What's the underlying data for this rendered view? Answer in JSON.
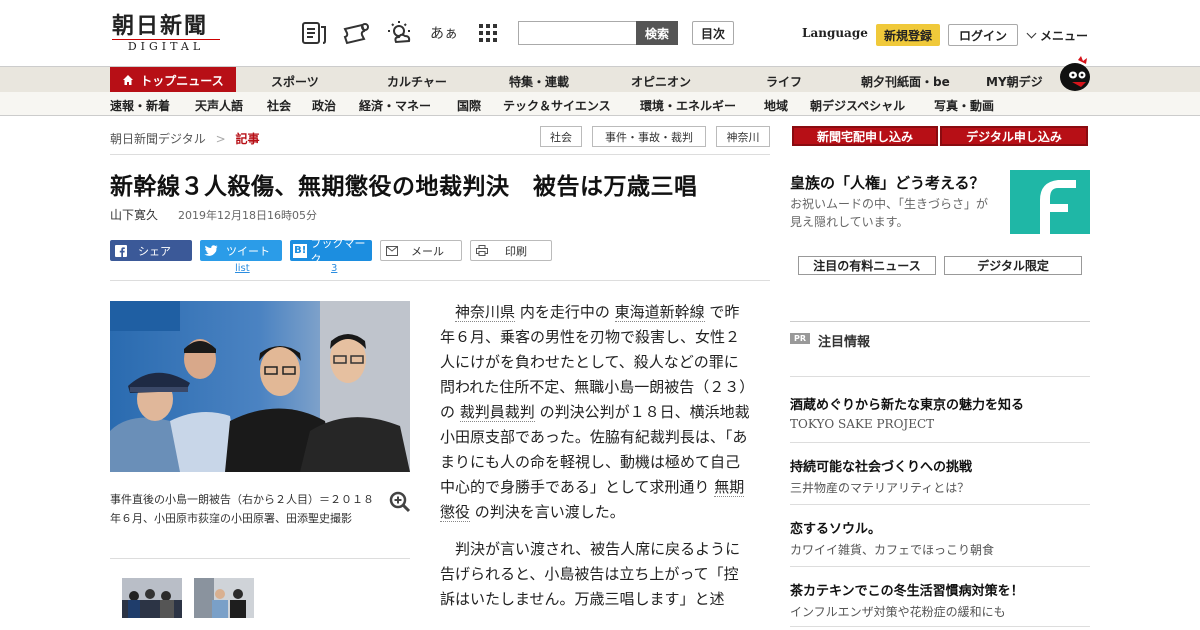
{
  "header": {
    "logo_main": "朝日新聞",
    "logo_sub": "DIGITAL",
    "icon_font_size": "あぁ",
    "search_placeholder": "",
    "search_button": "検索",
    "toc_button": "目次",
    "language": "Language",
    "signup": "新規登録",
    "login": "ログイン",
    "menu": "メニュー"
  },
  "nav_primary": [
    "トップニュース",
    "スポーツ",
    "カルチャー",
    "特集・連載",
    "オピニオン",
    "ライフ",
    "朝夕刊紙面・be",
    "MY朝デジ"
  ],
  "nav_secondary": [
    "速報・新着",
    "天声人語",
    "社会",
    "政治",
    "経済・マネー",
    "国際",
    "テック＆サイエンス",
    "環境・エネルギー",
    "地域",
    "朝デジスペシャル",
    "写真・動画"
  ],
  "breadcrumb": {
    "home": "朝日新聞デジタル",
    "sep": ">",
    "current": "記事"
  },
  "tags": [
    "社会",
    "事件・事故・裁判",
    "神奈川"
  ],
  "article": {
    "headline": "新幹線３人殺傷、無期懲役の地裁判決　被告は万歳三唱",
    "author": "山下寛久",
    "date": "2019年12月18日16時05分",
    "share": {
      "facebook": "シェア",
      "twitter": "ツイート",
      "hatena": "ブックマーク",
      "mail": "メール",
      "print": "印刷"
    },
    "share_counts": {
      "twitter": "list",
      "hatena": "3"
    },
    "caption": "事件直後の小島一朗被告（右から２人目）＝２０１８年６月、小田原市荻窪の小田原署、田添聖史撮影",
    "p1_a": "神奈川県",
    "p1_b": "内を走行中の",
    "p1_c": "東海道新幹線",
    "p1_d": "で昨年６月、乗客の男性を刃物で殺害し、女性２人にけがを負わせたとして、殺人などの罪に問われた住所不定、無職小島一朗被告（２３）の",
    "p1_e": "裁判員裁判",
    "p1_f": "の判決公判が１８日、横浜地裁小田原支部であった。佐脇有紀裁判長は、「あまりにも人の命を軽視し、動機は極めて自己中心的で身勝手である」として求刑通り",
    "p1_g": "無期懲役",
    "p1_h": "の判決を言い渡した。",
    "p2": "判決が言い渡され、被告人席に戻るように告げられると、小島被告は立ち上がって「控訴はいたしません。万歳三唱します」と述"
  },
  "sidebar": {
    "btn_newspaper": "新聞宅配申し込み",
    "btn_digital": "デジタル申し込み",
    "feature_title": "皇族の「人権」どう考える？",
    "feature_desc": "お祝いムードの中、「生きづらさ」が見え隠れしています。",
    "tab_paid": "注目の有料ニュース",
    "tab_digital": "デジタル限定",
    "pr_badge": "PR",
    "pr_label": "注目情報",
    "pr_items": [
      {
        "title": "酒蔵めぐりから新たな東京の魅力を知る",
        "sub": "TOKYO SAKE PROJECT"
      },
      {
        "title": "持続可能な社会づくりへの挑戦",
        "sub": "三井物産のマテリアリティとは？"
      },
      {
        "title": "恋するソウル。",
        "sub": "カワイイ雑貨、カフェでほっこり朝食"
      },
      {
        "title": "茶カテキンでこの冬生活習慣病対策を！",
        "sub": "インフルエンザ対策や花粉症の緩和にも"
      }
    ]
  },
  "colors": {
    "brand_red": "#b70f16",
    "facebook": "#3b5998",
    "twitter": "#2b9ce8",
    "hatena": "#1c8ee0",
    "feature_teal": "#1fb7a6",
    "signup_yellow": "#f0c93a"
  }
}
